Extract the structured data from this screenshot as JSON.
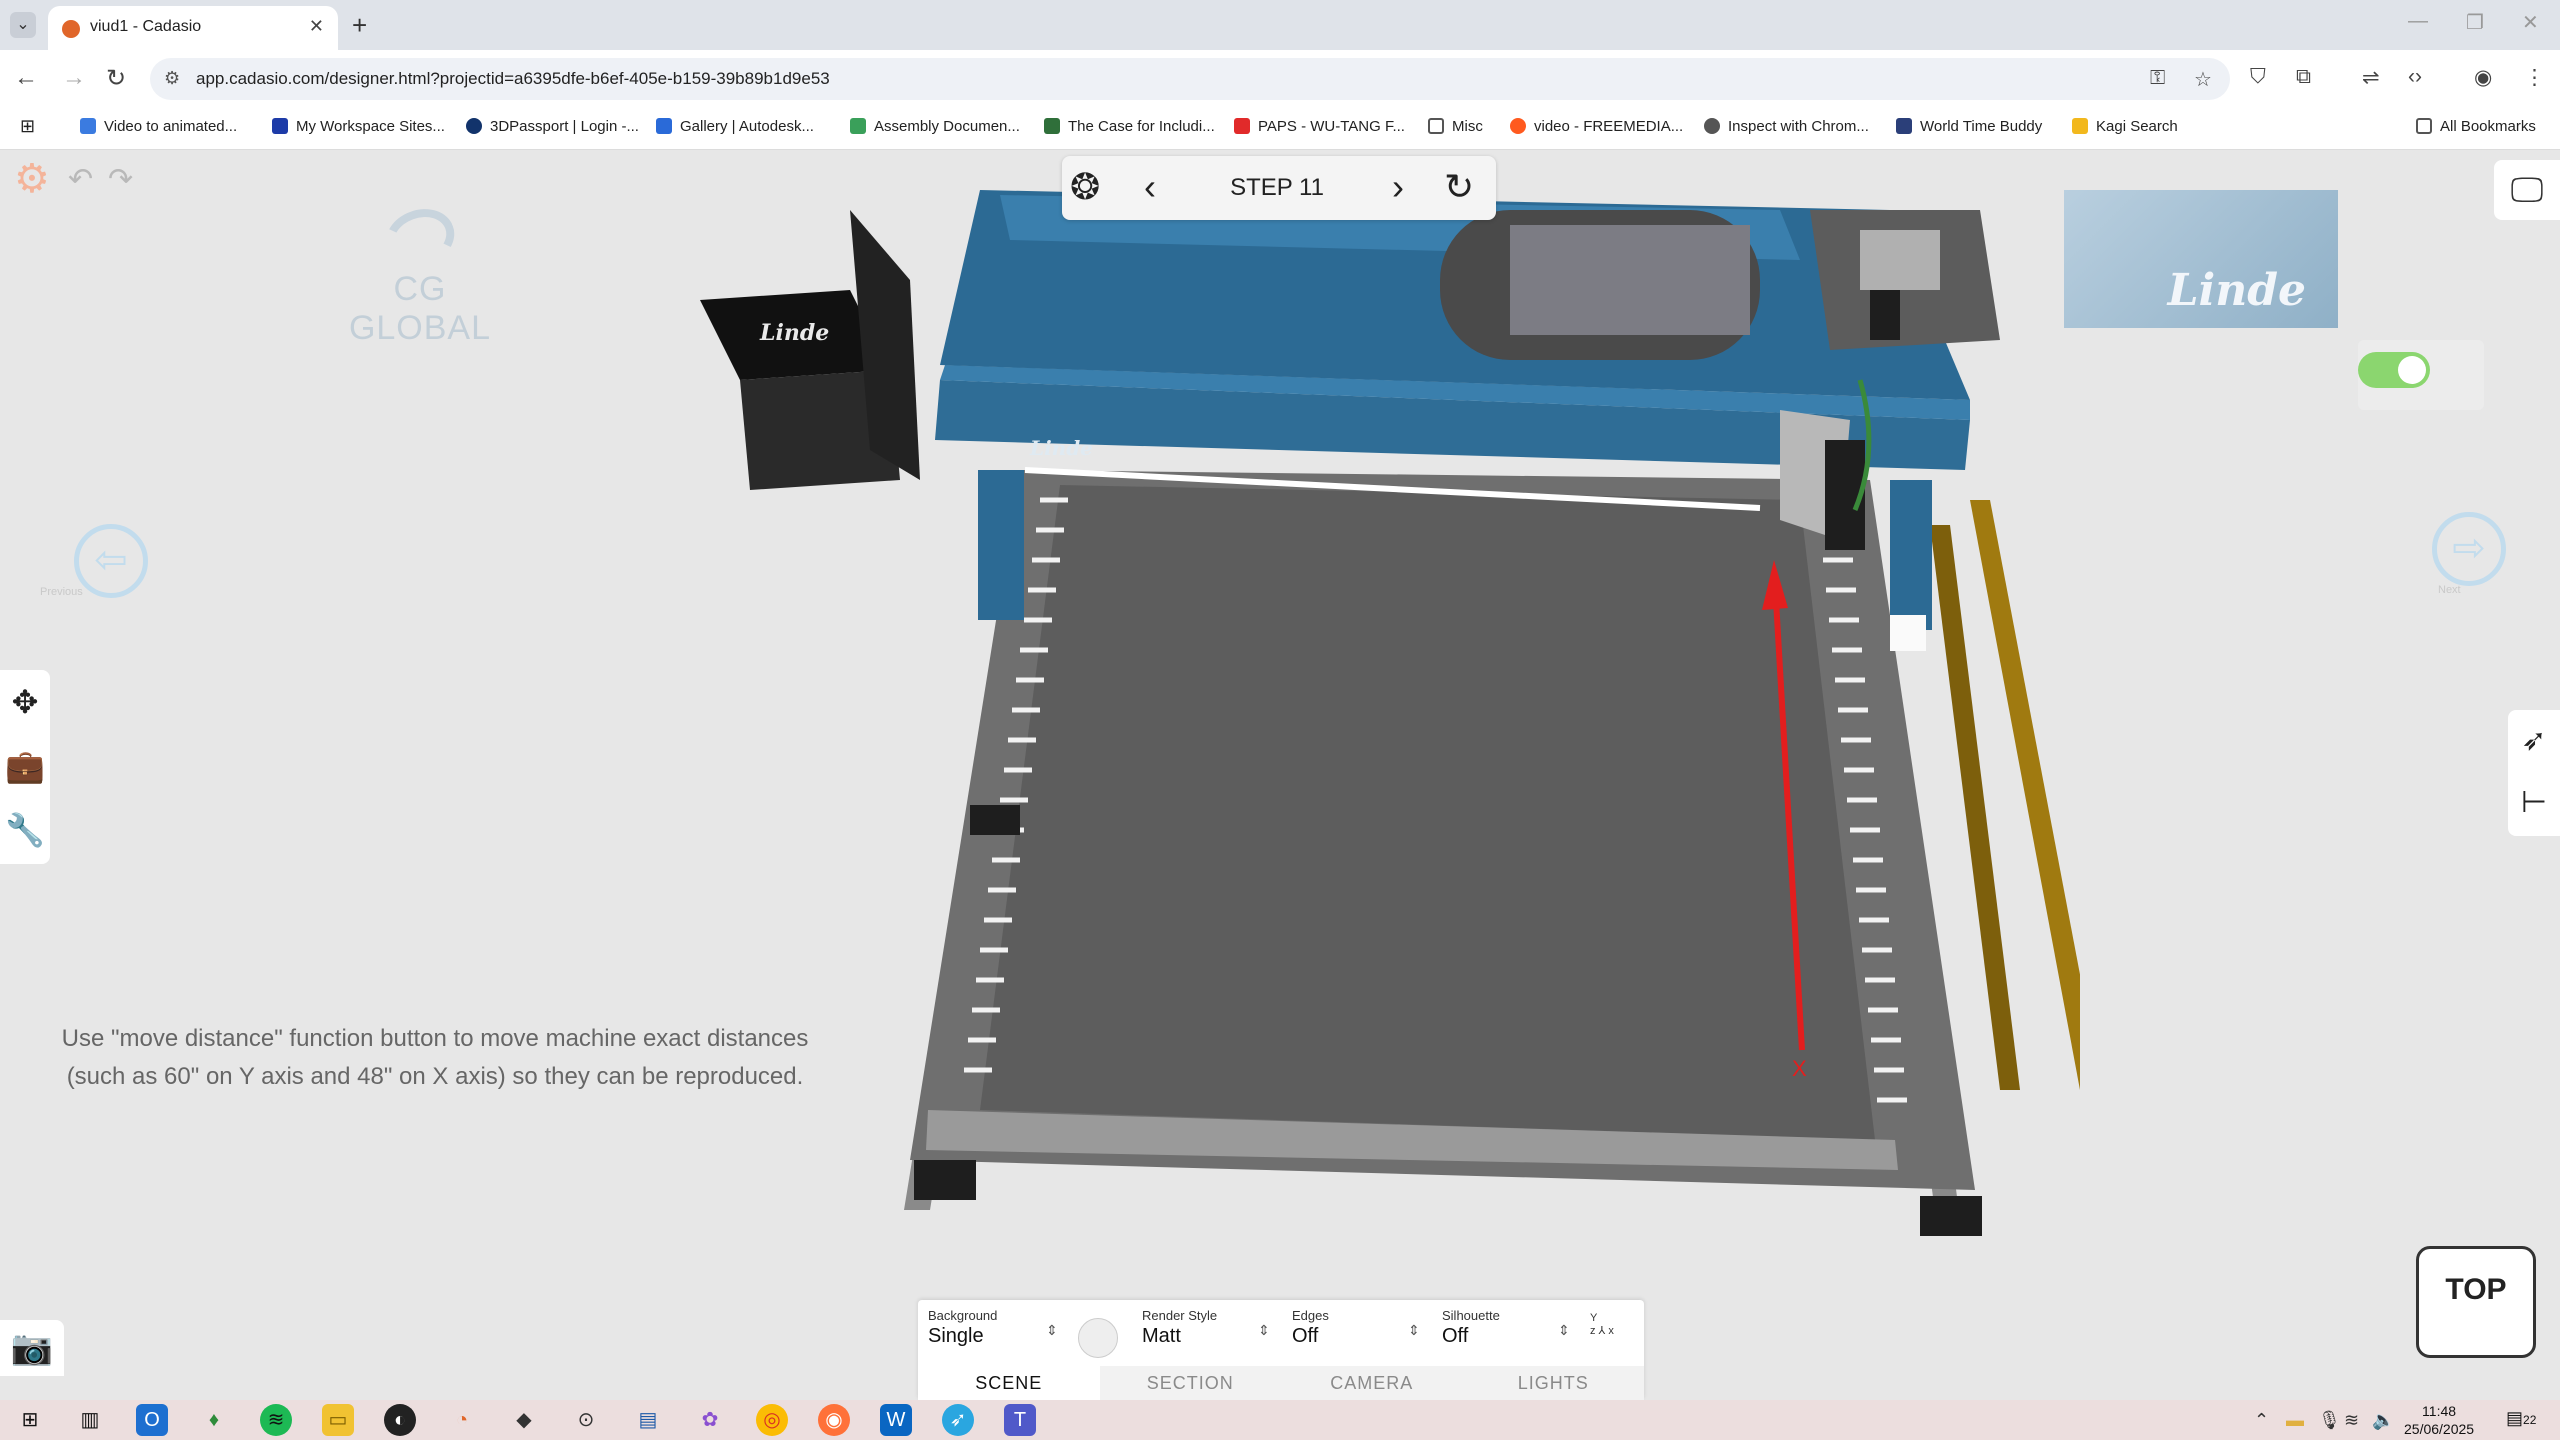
{
  "browser": {
    "tab_title": "viud1 - Cadasio",
    "url": "app.cadasio.com/designer.html?projectid=a6395dfe-b6ef-405e-b159-39b89b1d9e53",
    "bookmarks": [
      {
        "label": "Video to animated...",
        "color": "#3b7be0"
      },
      {
        "label": "My Workspace Sites...",
        "color": "#1d3ba8"
      },
      {
        "label": "3DPassport | Login -...",
        "color": "#12336b"
      },
      {
        "label": "Gallery | Autodesk...",
        "color": "#2a6ad8"
      },
      {
        "label": "Assembly Documen...",
        "color": "#3aa05a"
      },
      {
        "label": "The Case for Includi...",
        "color": "#2f6f3a"
      },
      {
        "label": "PAPS - WU-TANG F...",
        "color": "#e12a2a"
      },
      {
        "label": "Misc",
        "color": "#6b6b6b"
      },
      {
        "label": "video - FREEMEDIA...",
        "color": "#ff5a1f"
      },
      {
        "label": "Inspect with Chrom...",
        "color": "#555555"
      },
      {
        "label": "World Time Buddy",
        "color": "#2b3f79"
      },
      {
        "label": "Kagi Search",
        "color": "#f2b81d"
      }
    ],
    "all_bookmarks": "All Bookmarks"
  },
  "app": {
    "step_label": "STEP 11",
    "logo_text": "CG GLOBAL",
    "brand_word": "Linde",
    "previous_label": "Previous",
    "next_label": "Next",
    "instruction": "Use \"move distance\" function button to move machine exact distances (such as 60\" on Y axis and 48\" on X axis) so they can be reproduced.",
    "axis_label": "X",
    "top_view_label": "TOP",
    "toggle_on": true,
    "accent_color": "#e0662a"
  },
  "settings": {
    "background_label": "Background",
    "background_value": "Single",
    "render_style_label": "Render Style",
    "render_style_value": "Matt",
    "edges_label": "Edges",
    "edges_value": "Off",
    "silhouette_label": "Silhouette",
    "silhouette_value": "Off",
    "tabs": [
      "SCENE",
      "SECTION",
      "CAMERA",
      "LIGHTS"
    ],
    "active_tab": "SCENE"
  },
  "taskbar": {
    "time": "11:48",
    "date": "25/06/2025",
    "notifications": "22"
  }
}
